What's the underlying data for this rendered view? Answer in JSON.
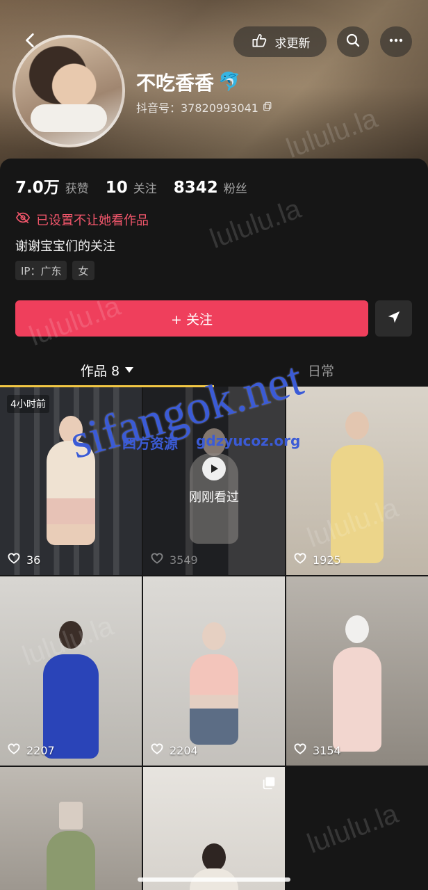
{
  "header": {
    "update_label": "求更新",
    "nickname": "不吃香香",
    "douyin_id": "抖音号：37820993041"
  },
  "stats": [
    {
      "value": "7.0万",
      "label": "获赞"
    },
    {
      "value": "10",
      "label": "关注"
    },
    {
      "value": "8342",
      "label": "粉丝"
    }
  ],
  "profile": {
    "restricted_notice": "已设置不让她看作品",
    "bio": "谢谢宝宝们的关注",
    "tags": [
      "IP：广东",
      "女"
    ],
    "follow_label": "+ 关注"
  },
  "tabs": {
    "works_label": "作品 8",
    "daily_label": "日常"
  },
  "grid": {
    "time_badge": "4小时前",
    "seen_label": "刚刚看过",
    "likes": [
      "36",
      "3549",
      "1925",
      "2207",
      "2204",
      "3154"
    ]
  },
  "watermarks": {
    "tile_text": "lululu.la",
    "big_text": "sifangok.net",
    "small_left": "四方资源",
    "small_right": "gdzyucoz.org"
  },
  "colors": {
    "accent": "#ef3f5c",
    "tab_indicator": "#f2c744",
    "restricted": "#f2566b"
  },
  "icons": {
    "back": "chevron-left-icon",
    "update": "hand-pointing-icon",
    "search": "search-icon",
    "more": "more-dots-icon",
    "share": "send-icon",
    "likes": "heart-icon",
    "copy": "copy-icon",
    "restricted": "eye-off-icon",
    "play": "play-icon",
    "multi": "multi-image-icon"
  }
}
